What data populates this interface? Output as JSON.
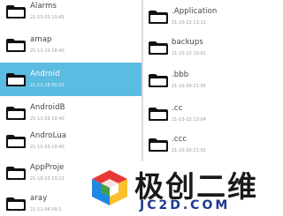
{
  "left_pane": {
    "items": [
      {
        "name": "Alarms",
        "meta": "21-11-03 10:45"
      },
      {
        "name": "amap",
        "meta": "21-11-10 18:40"
      },
      {
        "name": "Android",
        "meta": "21-11-18 00:25",
        "selected": true
      },
      {
        "name": "AndroidB",
        "meta": "21-11-03 10:40"
      },
      {
        "name": "AndroLua",
        "meta": "21-11-03 10:40"
      },
      {
        "name": "AppProje",
        "meta": "21-10-23 13:12"
      },
      {
        "name": "aray",
        "meta": "21-11-04 00:1"
      }
    ]
  },
  "right_pane": {
    "items": [
      {
        "name": ".Application",
        "meta": "21-10-23 13:12"
      },
      {
        "name": "backups",
        "meta": "21-10-23 10:01"
      },
      {
        "name": ".bbb",
        "meta": "21-10-30 21:00"
      },
      {
        "name": ".cc",
        "meta": "21-10-22 13:04"
      },
      {
        "name": ".ccc",
        "meta": "21-10-30 21:00"
      }
    ]
  },
  "watermark": {
    "cn": "极创二维",
    "en": "JC2D.COM"
  },
  "colors": {
    "selection": "#5bbbe1",
    "folder": "#111111",
    "watermark_blue": "#1e3a8c"
  }
}
